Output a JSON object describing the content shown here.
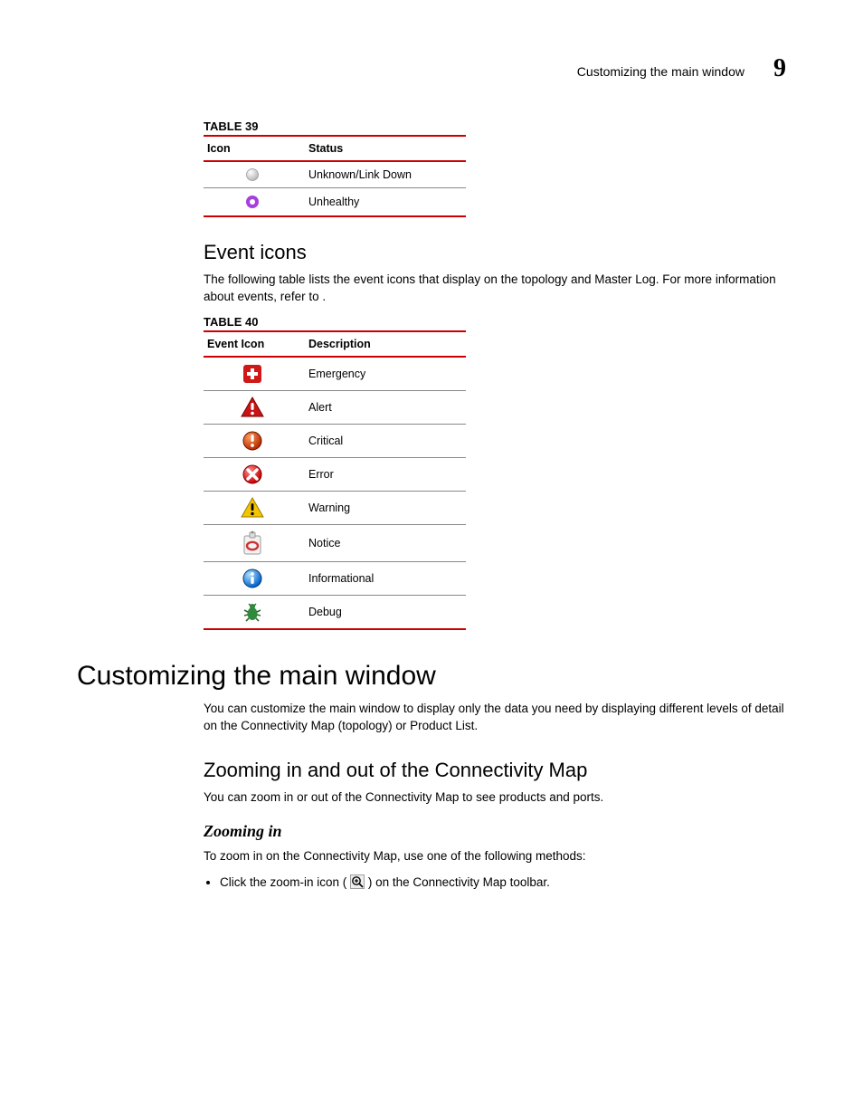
{
  "runningHead": {
    "title": "Customizing the main window",
    "chapter": "9"
  },
  "table39": {
    "caption": "TABLE 39",
    "headers": [
      "Icon",
      "Status"
    ],
    "rows": [
      {
        "icon": "status-unknown-icon",
        "status": "Unknown/Link Down"
      },
      {
        "icon": "status-unhealthy-icon",
        "status": "Unhealthy"
      }
    ]
  },
  "eventIcons": {
    "heading": "Event icons",
    "intro": "The following table lists the event icons that display on the topology and Master Log. For more information about events, refer to ."
  },
  "table40": {
    "caption": "TABLE 40",
    "headers": [
      "Event Icon",
      "Description"
    ],
    "rows": [
      {
        "icon": "event-emergency-icon",
        "desc": "Emergency"
      },
      {
        "icon": "event-alert-icon",
        "desc": "Alert"
      },
      {
        "icon": "event-critical-icon",
        "desc": "Critical"
      },
      {
        "icon": "event-error-icon",
        "desc": "Error"
      },
      {
        "icon": "event-warning-icon",
        "desc": "Warning"
      },
      {
        "icon": "event-notice-icon",
        "desc": "Notice"
      },
      {
        "icon": "event-informational-icon",
        "desc": "Informational"
      },
      {
        "icon": "event-debug-icon",
        "desc": "Debug"
      }
    ]
  },
  "customizing": {
    "heading": "Customizing the main window",
    "intro": "You can customize the main window to display only the data you need by displaying different levels of detail on the Connectivity Map (topology) or Product List."
  },
  "zooming": {
    "heading": "Zooming in and out of the Connectivity Map",
    "intro": "You can zoom in or out of the Connectivity Map to see products and ports."
  },
  "zoomingIn": {
    "heading": "Zooming in",
    "intro": "To zoom in on the Connectivity Map, use one of the following methods:",
    "bullet_pre": "Click the zoom-in icon (",
    "bullet_post": ") on the Connectivity Map toolbar."
  }
}
